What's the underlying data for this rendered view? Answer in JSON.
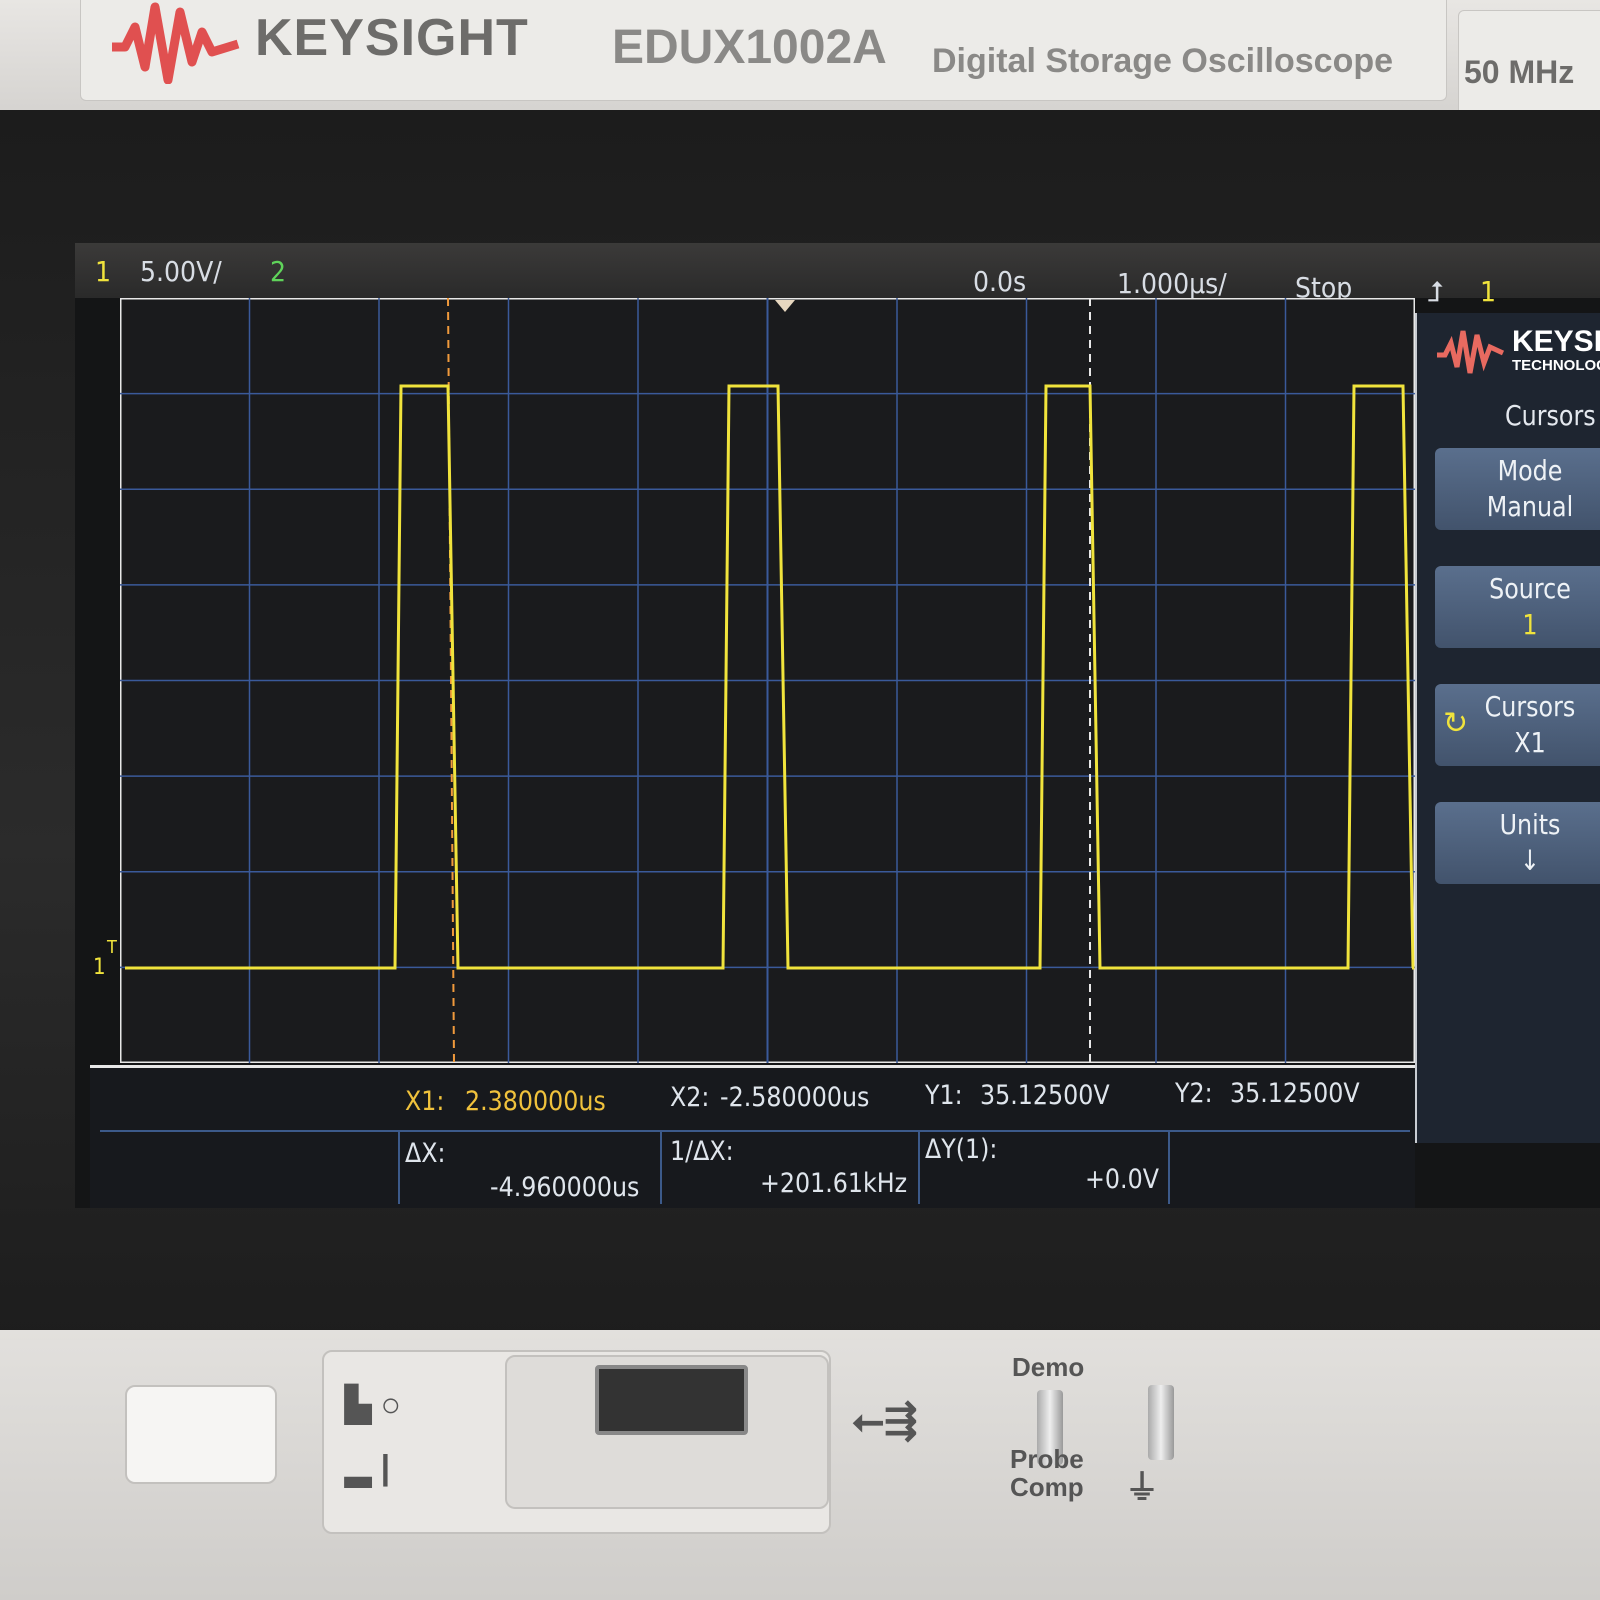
{
  "header": {
    "brand": "KEYSIGHT",
    "model": "EDUX1002A",
    "description": "Digital Storage Oscilloscope",
    "bandwidth": "50 MHz"
  },
  "status_bar": {
    "ch1_label": "1",
    "ch1_scale": "5.00V/",
    "ch2_label": "2",
    "time_delay": "0.0s",
    "time_scale": "1.000µs/",
    "run_state": "Stop",
    "trigger_icon": "trigger-edge-icon",
    "trigger_source": "1"
  },
  "ground_marker": "1",
  "trigger_marker": "T",
  "measurements": {
    "x1_label": "X1:",
    "x1_value": "2.380000us",
    "x2_label": "X2:",
    "x2_value": "-2.580000us",
    "y1_label": "Y1:",
    "y1_value": "35.12500V",
    "y2_label": "Y2:",
    "y2_value": "35.12500V",
    "dx_label": "ΔX:",
    "dx_value": "-4.960000us",
    "inv_dx_label": "1/ΔX:",
    "inv_dx_value": "+201.61kHz",
    "dy_label": "ΔY(1):",
    "dy_value": "+0.0V"
  },
  "softkeys": {
    "logo_text": "KEYSIGHT",
    "logo_sub": "TECHNOLOGIES",
    "menu_title": "Cursors",
    "items": [
      {
        "label": "Mode",
        "value": "Manual"
      },
      {
        "label": "Source",
        "value": "1"
      },
      {
        "label": "Cursors",
        "value": "X1",
        "icon": "rotate-knob-icon"
      },
      {
        "label": "Units",
        "value": "↓"
      }
    ]
  },
  "front_panel": {
    "demo_label": "Demo",
    "probe_comp_label": "Probe Comp",
    "usb_icon": "usb-icon",
    "ground_icon": "ground-icon"
  },
  "colors": {
    "ch1": "#f0e33c",
    "ch2": "#5fd35a",
    "cursor_x1": "#f09a3c",
    "grid": "#3a5a9a",
    "brand_red": "#e05050"
  }
}
